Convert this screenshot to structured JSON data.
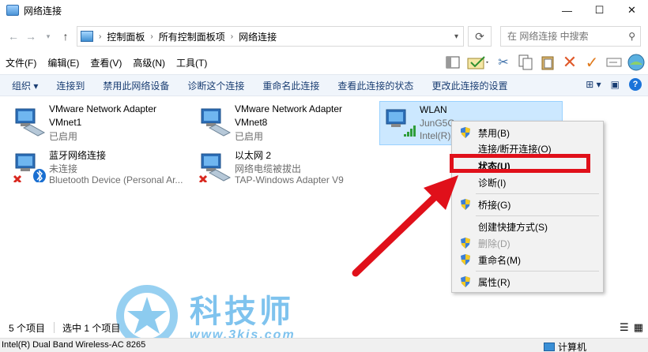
{
  "window": {
    "title": "网络连接",
    "controls": [
      "—",
      "☐",
      "✕"
    ]
  },
  "address": {
    "crumbs": [
      "控制面板",
      "所有控制面板项",
      "网络连接"
    ],
    "search_placeholder": "在 网络连接 中搜索"
  },
  "menu": [
    "文件(F)",
    "编辑(E)",
    "查看(V)",
    "高级(N)",
    "工具(T)"
  ],
  "commands": [
    "组织 ▾",
    "连接到",
    "禁用此网络设备",
    "诊断这个连接",
    "重命名此连接",
    "查看此连接的状态",
    "更改此连接的设置"
  ],
  "adapters": [
    {
      "name": "VMware Network Adapter",
      "status": "VMnet1",
      "device": "已启用"
    },
    {
      "name": "VMware Network Adapter",
      "status": "VMnet8",
      "device": "已启用"
    },
    {
      "name": "WLAN",
      "status": "JunG5G",
      "device": "Intel(R)"
    },
    {
      "name": "蓝牙网络连接",
      "status": "未连接",
      "device": "Bluetooth Device (Personal Ar..."
    },
    {
      "name": "以太网 2",
      "status": "网络电缆被拔出",
      "device": "TAP-Windows Adapter V9"
    }
  ],
  "context_menu": [
    {
      "label": "禁用(B)",
      "shield": true
    },
    {
      "label": "连接/断开连接(O)",
      "shield": false
    },
    {
      "label": "状态(U)",
      "shield": false,
      "bold": true
    },
    {
      "label": "诊断(I)",
      "shield": false
    },
    {
      "label": "桥接(G)",
      "shield": true
    },
    {
      "label": "创建快捷方式(S)",
      "shield": false
    },
    {
      "label": "删除(D)",
      "shield": true,
      "disabled": true
    },
    {
      "label": "重命名(M)",
      "shield": true
    },
    {
      "label": "属性(R)",
      "shield": true
    }
  ],
  "watermark": {
    "title": "科技师",
    "url": "www.3kjs.com"
  },
  "statusbar": {
    "count": "5 个项目",
    "selected": "选中 1 个项目"
  },
  "bottombar": {
    "left": "Intel(R) Dual Band Wireless-AC 8265",
    "right": "计算机"
  },
  "colors": {
    "highlight": "#e0101a",
    "arrow": "#e0101a",
    "selection": "#cce8ff",
    "command_bar": "#f0f5fb"
  }
}
